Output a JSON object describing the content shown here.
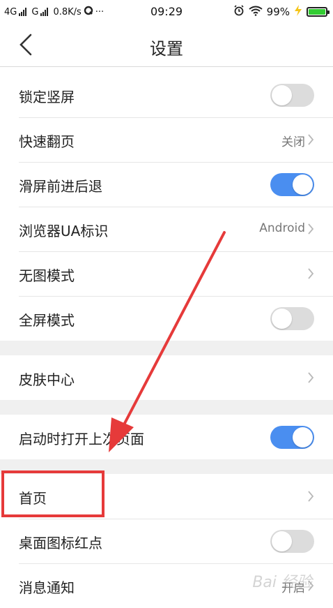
{
  "status_bar": {
    "network1": "4G",
    "network2": "G",
    "speed": "0.8K/s",
    "more": "···",
    "time": "09:29",
    "battery_pct": "99%",
    "battery_level": 0.99,
    "battery_color": "#33cc33"
  },
  "header": {
    "title": "设置"
  },
  "settings": [
    {
      "label": "锁定竖屏",
      "type": "toggle",
      "on": false
    },
    {
      "label": "快速翻页",
      "type": "value",
      "value": "关闭"
    },
    {
      "label": "滑屏前进后退",
      "type": "toggle",
      "on": true
    },
    {
      "label": "浏览器UA标识",
      "type": "value",
      "value": "Android"
    },
    {
      "label": "无图模式",
      "type": "chevron"
    },
    {
      "label": "全屏模式",
      "type": "toggle",
      "on": false
    },
    {
      "label": "皮肤中心",
      "type": "chevron"
    },
    {
      "label": "启动时打开上次页面",
      "type": "toggle",
      "on": true
    },
    {
      "label": "首页",
      "type": "chevron"
    },
    {
      "label": "桌面图标红点",
      "type": "toggle",
      "on": false
    },
    {
      "label": "消息通知",
      "type": "value",
      "value": "开启"
    }
  ],
  "colors": {
    "toggle_on": "#4a8ef0",
    "toggle_off": "#dcdcdc",
    "annotation": "#e63a3a"
  },
  "watermark": "Bai 经验"
}
